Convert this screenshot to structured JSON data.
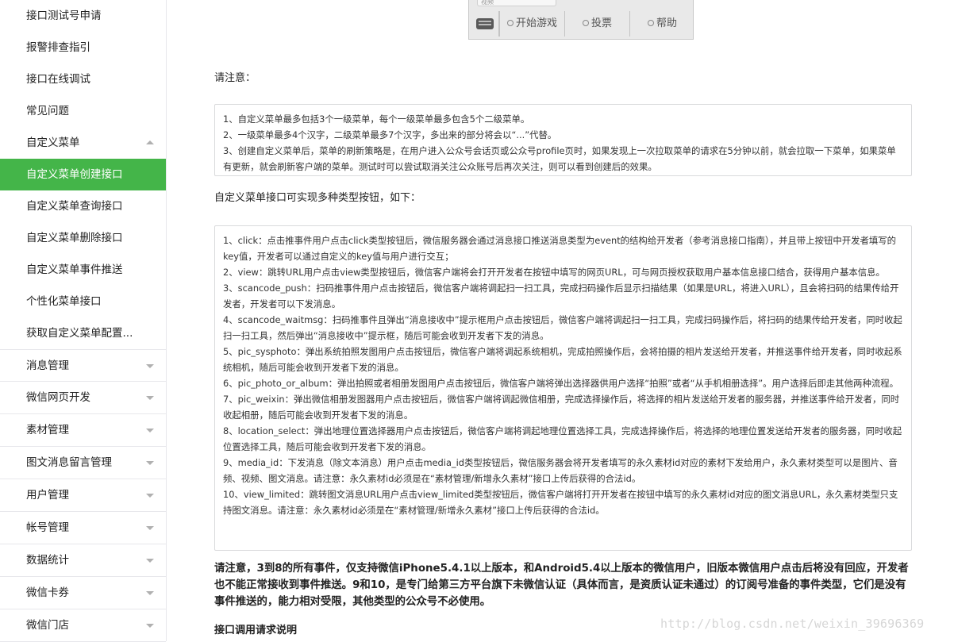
{
  "sidebar": {
    "items": [
      {
        "label": "接口测试号申请",
        "type": "sub"
      },
      {
        "label": "报警排查指引",
        "type": "sub"
      },
      {
        "label": "接口在线调试",
        "type": "sub"
      },
      {
        "label": "常见问题",
        "type": "sub"
      },
      {
        "label": "自定义菜单",
        "type": "section-open"
      },
      {
        "label": "自定义菜单创建接口",
        "type": "active"
      },
      {
        "label": "自定义菜单查询接口",
        "type": "sub"
      },
      {
        "label": "自定义菜单删除接口",
        "type": "sub"
      },
      {
        "label": "自定义菜单事件推送",
        "type": "sub"
      },
      {
        "label": "个性化菜单接口",
        "type": "sub"
      },
      {
        "label": "获取自定义菜单配置...",
        "type": "sub"
      },
      {
        "label": "消息管理",
        "type": "group"
      },
      {
        "label": "微信网页开发",
        "type": "group"
      },
      {
        "label": "素材管理",
        "type": "group"
      },
      {
        "label": "图文消息留言管理",
        "type": "group"
      },
      {
        "label": "用户管理",
        "type": "group"
      },
      {
        "label": "帐号管理",
        "type": "group"
      },
      {
        "label": "数据统计",
        "type": "group"
      },
      {
        "label": "微信卡券",
        "type": "group"
      },
      {
        "label": "微信门店",
        "type": "group"
      }
    ]
  },
  "phone_menu": {
    "chat_hint": "视频",
    "buttons": [
      "开始游戏",
      "投票",
      "帮助"
    ]
  },
  "notice_label": "请注意：",
  "rules": [
    "1、自定义菜单最多包括3个一级菜单，每个一级菜单最多包含5个二级菜单。",
    "2、一级菜单最多4个汉字，二级菜单最多7个汉字，多出来的部分将会以“...”代替。",
    "3、创建自定义菜单后，菜单的刷新策略是，在用户进入公众号会话页或公众号profile页时，如果发现上一次拉取菜单的请求在5分钟以前，就会拉取一下菜单，如果菜单有更新，就会刷新客户端的菜单。测试时可以尝试取消关注公众账号后再次关注，则可以看到创建后的效果。"
  ],
  "types_label": "自定义菜单接口可实现多种类型按钮，如下：",
  "button_types": [
    "1、click：点击推事件用户点击click类型按钮后，微信服务器会通过消息接口推送消息类型为event的结构给开发者（参考消息接口指南），并且带上按钮中开发者填写的key值，开发者可以通过自定义的key值与用户进行交互；",
    "2、view：跳转URL用户点击view类型按钮后，微信客户端将会打开开发者在按钮中填写的网页URL，可与网页授权获取用户基本信息接口结合，获得用户基本信息。",
    "3、scancode_push：扫码推事件用户点击按钮后，微信客户端将调起扫一扫工具，完成扫码操作后显示扫描结果（如果是URL，将进入URL），且会将扫码的结果传给开发者，开发者可以下发消息。",
    "4、scancode_waitmsg：扫码推事件且弹出“消息接收中”提示框用户点击按钮后，微信客户端将调起扫一扫工具，完成扫码操作后，将扫码的结果传给开发者，同时收起扫一扫工具，然后弹出“消息接收中”提示框，随后可能会收到开发者下发的消息。",
    "5、pic_sysphoto：弹出系统拍照发图用户点击按钮后，微信客户端将调起系统相机，完成拍照操作后，会将拍摄的相片发送给开发者，并推送事件给开发者，同时收起系统相机，随后可能会收到开发者下发的消息。",
    "6、pic_photo_or_album：弹出拍照或者相册发图用户点击按钮后，微信客户端将弹出选择器供用户选择“拍照”或者“从手机相册选择”。用户选择后即走其他两种流程。",
    "7、pic_weixin：弹出微信相册发图器用户点击按钮后，微信客户端将调起微信相册，完成选择操作后，将选择的相片发送给开发者的服务器，并推送事件给开发者，同时收起相册，随后可能会收到开发者下发的消息。",
    "8、location_select：弹出地理位置选择器用户点击按钮后，微信客户端将调起地理位置选择工具，完成选择操作后，将选择的地理位置发送给开发者的服务器，同时收起位置选择工具，随后可能会收到开发者下发的消息。",
    "9、media_id：下发消息（除文本消息）用户点击media_id类型按钮后，微信服务器会将开发者填写的永久素材id对应的素材下发给用户，永久素材类型可以是图片、音频、视频、图文消息。请注意：永久素材id必须是在“素材管理/新增永久素材”接口上传后获得的合法id。",
    "10、view_limited：跳转图文消息URL用户点击view_limited类型按钮后，微信客户端将打开开发者在按钮中填写的永久素材id对应的图文消息URL，永久素材类型只支持图文消息。请注意：永久素材id必须是在“素材管理/新增永久素材”接口上传后获得的合法id。"
  ],
  "warning": "请注意，3到8的所有事件，仅支持微信iPhone5.4.1以上版本，和Android5.4以上版本的微信用户，旧版本微信用户点击后将没有回应，开发者也不能正常接收到事件推送。9和10，是专门给第三方平台旗下未微信认证（具体而言，是资质认证未通过）的订阅号准备的事件类型，它们是没有事件推送的，能力相对受限，其他类型的公众号不必使用。",
  "subheading": "接口调用请求说明",
  "watermark": "http://blog.csdn.net/weixin_39696369",
  "colors": {
    "active": "#44b549",
    "border": "#d9dadc"
  }
}
